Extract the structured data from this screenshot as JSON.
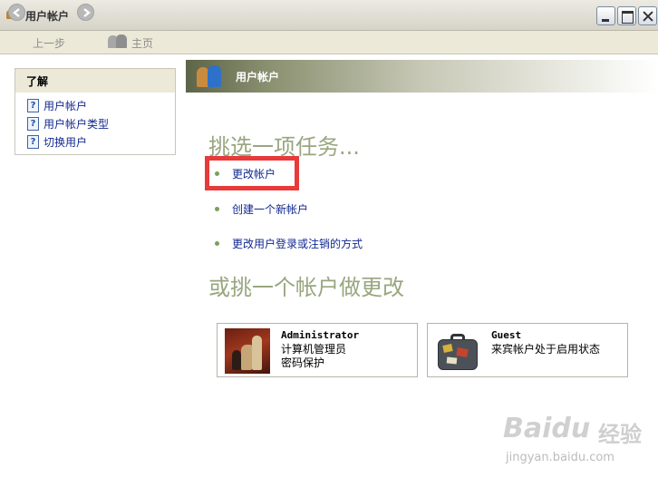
{
  "window": {
    "title": "用户帐户"
  },
  "toolbar": {
    "back_label": "上一步",
    "home_label": "主页"
  },
  "sidebar": {
    "header": "了解",
    "items": [
      {
        "label": "用户帐户"
      },
      {
        "label": "用户帐户类型"
      },
      {
        "label": "切换用户"
      }
    ]
  },
  "banner": {
    "title": "用户帐户"
  },
  "tasks": {
    "heading": "挑选一项任务...",
    "items": [
      {
        "label": "更改帐户"
      },
      {
        "label": "创建一个新帐户"
      },
      {
        "label": "更改用户登录或注销的方式"
      }
    ]
  },
  "accounts": {
    "heading": "或挑一个帐户做更改",
    "items": [
      {
        "name": "Administrator",
        "line1": "计算机管理员",
        "line2": "密码保护"
      },
      {
        "name": "Guest",
        "line1": "来宾帐户处于启用状态"
      }
    ]
  },
  "watermark": {
    "main": "Baidu",
    "cn": "经验",
    "url": "jingyan.baidu.com"
  },
  "colors": {
    "highlight": "#e83a3a",
    "link": "#12288f",
    "heading": "#99a67f"
  }
}
